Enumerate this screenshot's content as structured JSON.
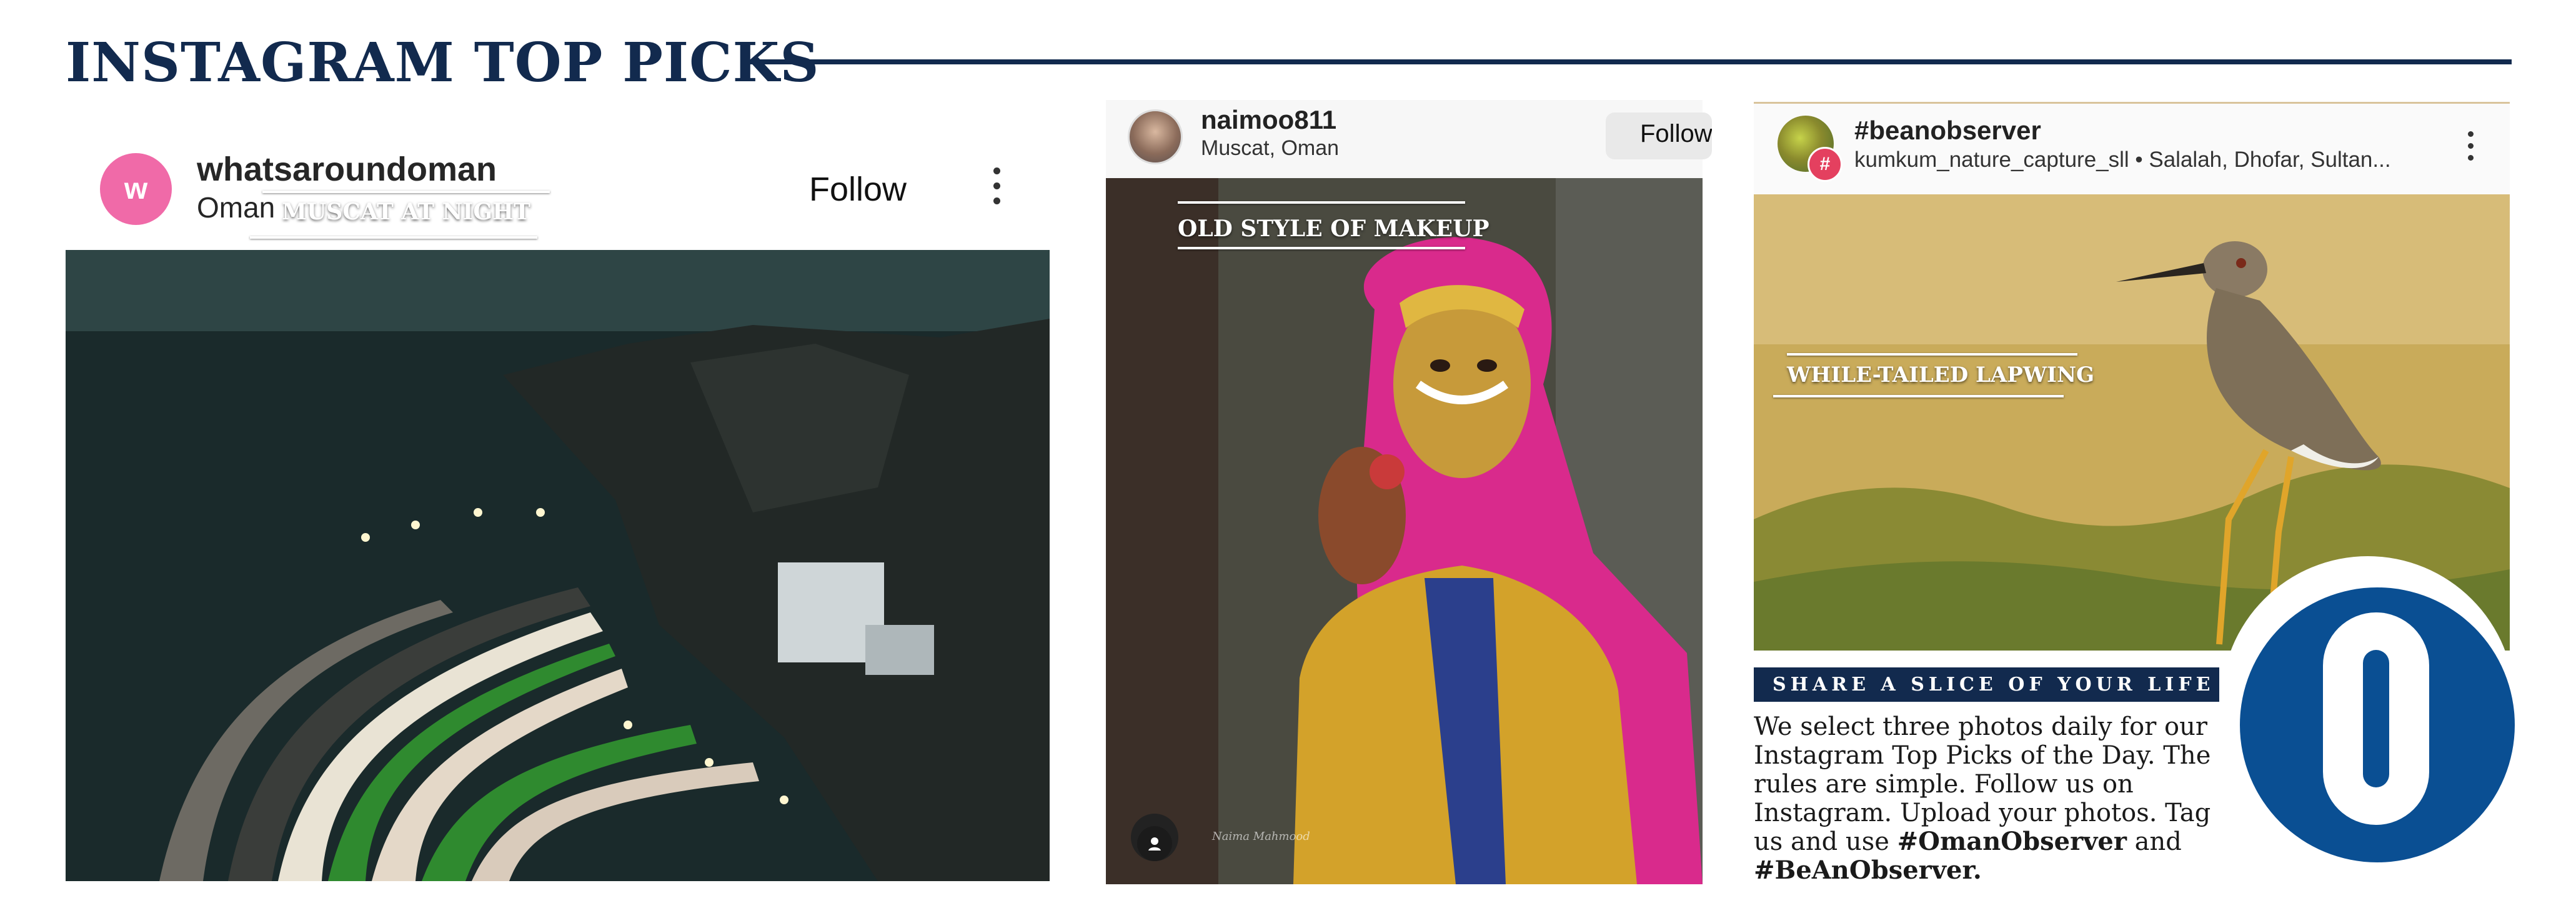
{
  "header": {
    "title": "INSTAGRAM TOP PICKS"
  },
  "posts": [
    {
      "avatar_letter": "w",
      "username": "whatsaroundoman",
      "location": "Oman",
      "follow_label": "Follow",
      "caption": "MUSCAT AT NIGHT"
    },
    {
      "username": "naimoo811",
      "location": "Muscat, Oman",
      "follow_label": "Follow",
      "caption": "OLD STYLE OF MAKEUP",
      "watermark": "Naima Mahmood"
    },
    {
      "username": "#beanobserver",
      "location": "kumkum_nature_capture_sll • Salalah, Dhofar, Sultan...",
      "caption": "WHILE-TAILED LAPWING"
    }
  ],
  "promo": {
    "banner": "SHARE A SLICE OF YOUR LIFE",
    "text": "We select three photos daily for our Instagram Top Picks of the Day. The rules are simple. Follow us on Instagram. Upload your photos. Tag us and use",
    "hashtag_1": "#OmanObserver",
    "and": "and",
    "hashtag_2": "#BeAnObserver."
  },
  "colors": {
    "navy": "#122a4e",
    "logo_blue": "#0a4f93",
    "avatar_pink": "#f06aa8"
  },
  "icons": [
    "more-vertical-icon",
    "instagram-hashtag-icon",
    "camera-icon",
    "oman-observer-logo"
  ]
}
